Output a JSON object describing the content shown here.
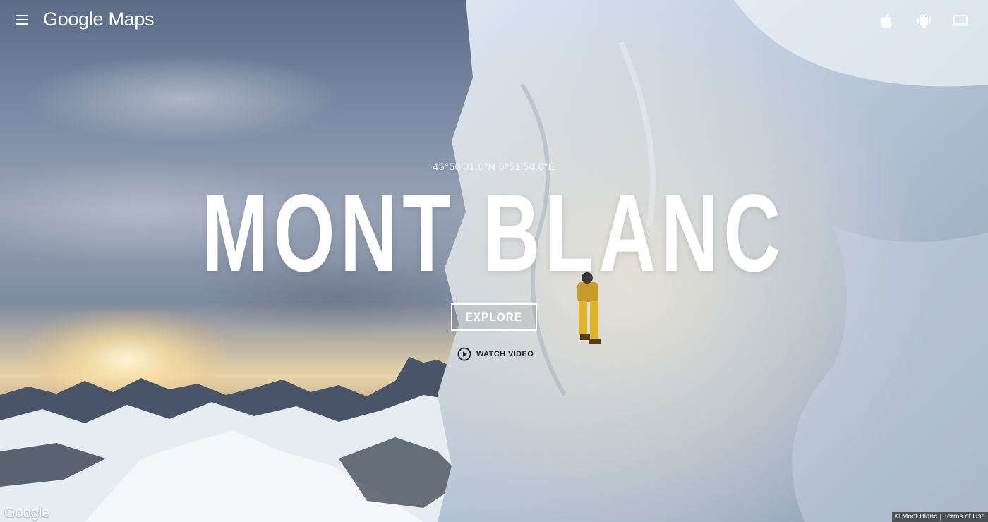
{
  "header": {
    "brand": "Google Maps",
    "menu_icon": "hamburger-menu-icon",
    "platform_icons": [
      "apple-icon",
      "android-icon",
      "laptop-icon"
    ]
  },
  "hero": {
    "coordinates": "45°50'01.0\"N 6°51'54.0\"E",
    "title": "MONT BLANC",
    "explore_label": "EXPLORE",
    "watch_label": "WATCH VIDEO",
    "watch_icon": "play-circle-icon"
  },
  "footer": {
    "logo": "Google",
    "copyright": "© Mont Blanc",
    "terms": "Terms of Use"
  },
  "colors": {
    "text": "#ffffff",
    "watch_text": "#1e2228",
    "footer_bg": "#282828"
  }
}
